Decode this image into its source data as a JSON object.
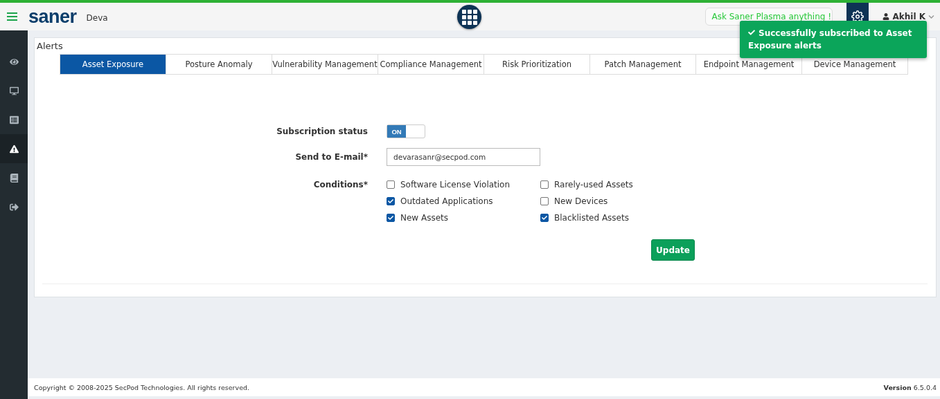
{
  "header": {
    "logo": "saner",
    "org": "Deva",
    "search": {
      "placeholder": "Ask Saner Plasma anything !"
    },
    "user": "Akhil K"
  },
  "sidebar": {
    "items": [
      {
        "selected": false
      },
      {
        "selected": false
      },
      {
        "selected": false
      },
      {
        "selected": true
      },
      {
        "selected": false
      },
      {
        "selected": false
      }
    ]
  },
  "page_title": "Alerts",
  "tabs": [
    {
      "label": "Asset Exposure",
      "selected": true
    },
    {
      "label": "Posture Anomaly",
      "selected": false
    },
    {
      "label": "Vulnerability Management",
      "selected": false
    },
    {
      "label": "Compliance Management",
      "selected": false
    },
    {
      "label": "Risk Prioritization",
      "selected": false
    },
    {
      "label": "Patch Management",
      "selected": false
    },
    {
      "label": "Endpoint Management",
      "selected": false
    },
    {
      "label": "Device Management",
      "selected": false
    }
  ],
  "form": {
    "subscription": {
      "label": "Subscription status",
      "on": true,
      "on_text": "ON"
    },
    "email": {
      "label": "Send to E-mail*",
      "value": "devarasanr@secpod.com"
    },
    "conditions_label": "Conditions*",
    "conditions": [
      {
        "label": "Software License Violation",
        "checked": false
      },
      {
        "label": "Rarely-used Assets",
        "checked": false
      },
      {
        "label": "Outdated Applications",
        "checked": true
      },
      {
        "label": "New Devices",
        "checked": false
      },
      {
        "label": "New Assets",
        "checked": true
      },
      {
        "label": "Blacklisted Assets",
        "checked": true
      }
    ],
    "button": "Update"
  },
  "toast": {
    "message": "Successfully subscribed to Asset Exposure alerts"
  },
  "footer": {
    "copyright": "Copyright © 2008-2025 SecPod Technologies. All rights reserved.",
    "version": "**Version** 6.5.0.4"
  }
}
